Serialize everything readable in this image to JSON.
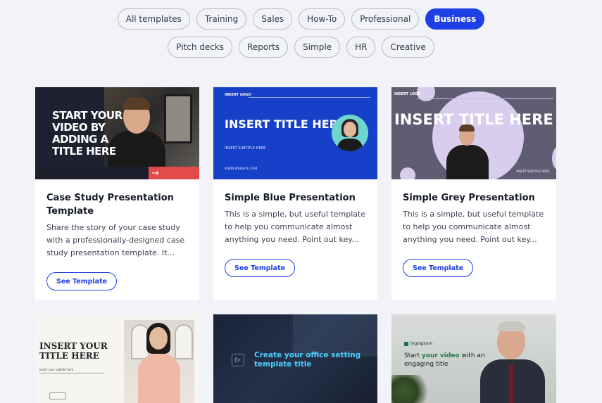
{
  "filters": {
    "row1": [
      {
        "label": "All templates",
        "active": false
      },
      {
        "label": "Training",
        "active": false
      },
      {
        "label": "Sales",
        "active": false
      },
      {
        "label": "How-To",
        "active": false
      },
      {
        "label": "Professional",
        "active": false
      },
      {
        "label": "Business",
        "active": true
      }
    ],
    "row2": [
      {
        "label": "Pitch decks",
        "active": false
      },
      {
        "label": "Reports",
        "active": false
      },
      {
        "label": "Simple",
        "active": false
      },
      {
        "label": "HR",
        "active": false
      },
      {
        "label": "Creative",
        "active": false
      }
    ]
  },
  "colors": {
    "accent": "#1f3fe6",
    "page_bg": "#f1f3f8",
    "chip_border": "#b7bbc6"
  },
  "cards": [
    {
      "title": "Case Study Presentation Template",
      "description": "Share the story of your case study with a professionally-designed case study presentation template. It...",
      "button": "See Template",
      "thumb": {
        "title": "START YOUR VIDEO BY ADDING A TITLE HERE",
        "arrow_icon": "arrow-right-icon"
      }
    },
    {
      "title": "Simple Blue Presentation",
      "description": "This is a simple, but useful template to help you communicate almost anything you need. Point out key...",
      "button": "See Template",
      "thumb": {
        "logo": "INSERT LOGO",
        "title": "INSERT TITLE HERE",
        "subtitle": "INSERT SUBTITLE HERE",
        "url": "WWW.WEBSITE.COM"
      }
    },
    {
      "title": "Simple Grey Presentation",
      "description": "This is a simple, but useful template to help you communicate almost anything you need. Point out key...",
      "button": "See Template",
      "thumb": {
        "logo": "INSERT LOGO",
        "title": "INSERT TITLE HERE",
        "subtitle": "INSERT SUBTITLE HERE"
      }
    },
    {
      "thumb": {
        "title": "INSERT YOUR TITLE HERE",
        "subtitle": "Insert your subtitle here"
      }
    },
    {
      "thumb": {
        "title": "Create your office setting template title"
      }
    },
    {
      "thumb": {
        "logo": "logoipsum",
        "title_pre": "Start ",
        "title_hl": "your video",
        "title_post": " with an engaging title"
      }
    }
  ]
}
